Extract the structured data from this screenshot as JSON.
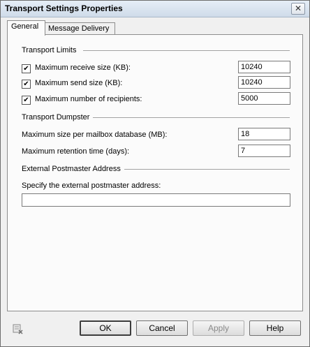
{
  "window": {
    "title": "Transport Settings Properties",
    "close_glyph": "✕"
  },
  "tabs": [
    {
      "label": "General",
      "active": true
    },
    {
      "label": "Message Delivery",
      "active": false
    }
  ],
  "transport_limits": {
    "title": "Transport Limits",
    "rows": [
      {
        "label": "Maximum receive size (KB):",
        "checked": true,
        "value": "10240"
      },
      {
        "label": "Maximum send size (KB):",
        "checked": true,
        "value": "10240"
      },
      {
        "label": "Maximum number of recipients:",
        "checked": true,
        "value": "5000"
      }
    ]
  },
  "transport_dumpster": {
    "title": "Transport Dumpster",
    "rows": [
      {
        "label": "Maximum size per mailbox database (MB):",
        "value": "18"
      },
      {
        "label": "Maximum retention time (days):",
        "value": "7"
      }
    ]
  },
  "postmaster": {
    "title": "External Postmaster Address",
    "label": "Specify the external postmaster address:",
    "value": ""
  },
  "footer": {
    "status_icon": "properties-status-icon",
    "buttons": [
      {
        "label": "OK",
        "default": true,
        "enabled": true
      },
      {
        "label": "Cancel",
        "enabled": true
      },
      {
        "label": "Apply",
        "enabled": false
      },
      {
        "label": "Help",
        "enabled": true
      }
    ]
  },
  "check_glyph": "✔"
}
